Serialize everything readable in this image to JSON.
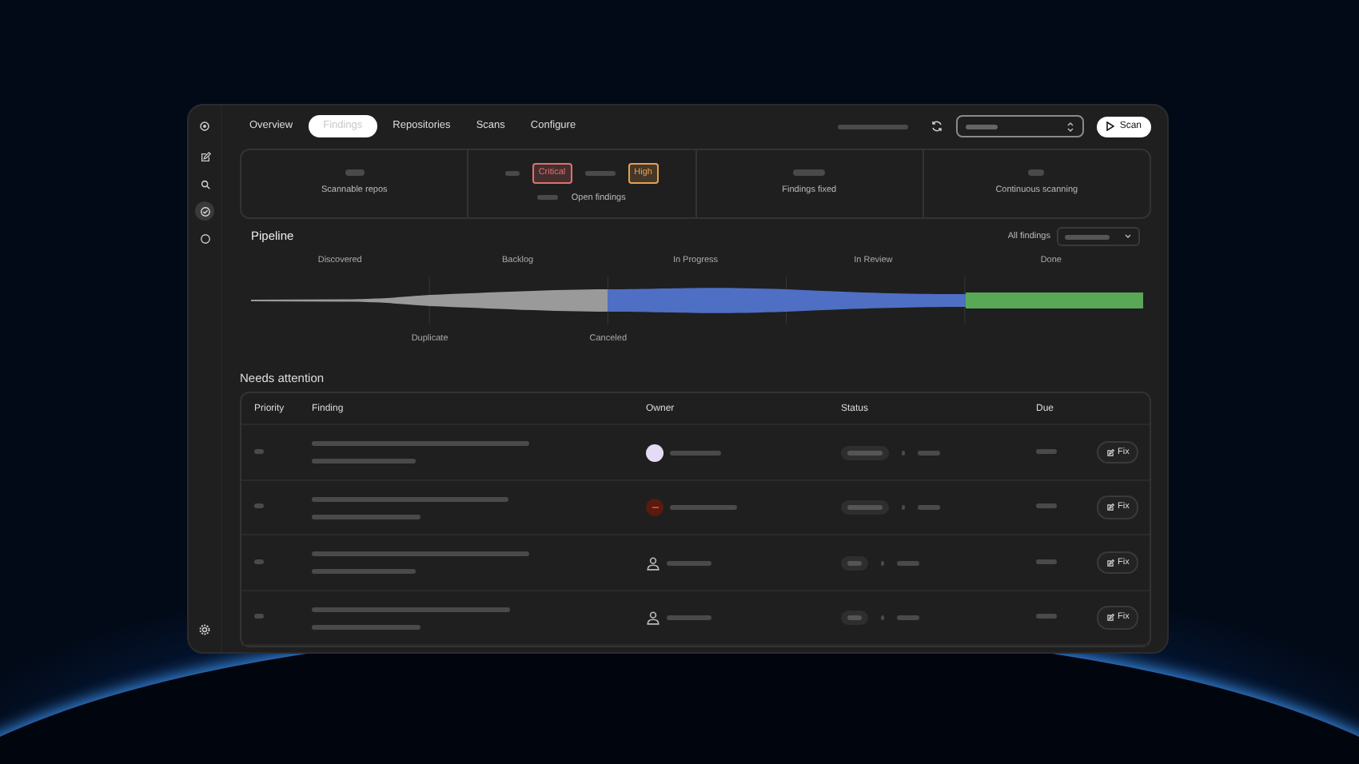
{
  "sidebar": {
    "items": [
      {
        "kind": "edit",
        "selected": false
      },
      {
        "kind": "search",
        "selected": false
      },
      {
        "kind": "check",
        "selected": true
      },
      {
        "kind": "chat",
        "selected": false
      }
    ]
  },
  "tabs": [
    {
      "label": "Overview",
      "selected": false
    },
    {
      "label": "Findings",
      "selected": true
    },
    {
      "label": "Repositories",
      "selected": false
    },
    {
      "label": "Scans",
      "selected": false
    },
    {
      "label": "Configure",
      "selected": false
    }
  ],
  "scan_button": "Scan",
  "stats": [
    {
      "label": "Scannable repos",
      "kind": "plain"
    },
    {
      "label": "Open findings",
      "kind": "severity",
      "badges": [
        {
          "label": "Critical",
          "color": "#e07070"
        },
        {
          "label": "High",
          "color": "#e8a050"
        }
      ]
    },
    {
      "label": "Findings fixed",
      "kind": "plain"
    },
    {
      "label": "Continuous scanning",
      "kind": "plain"
    }
  ],
  "pipeline": {
    "title": "Pipeline",
    "filter_label": "All findings",
    "stages": [
      "Discovered",
      "Backlog",
      "In Progress",
      "In Review",
      "Done"
    ],
    "exits": [
      "Duplicate",
      "Canceled"
    ]
  },
  "attention": {
    "title": "Needs attention",
    "columns": [
      "Priority",
      "Finding",
      "Owner",
      "Status",
      "Due"
    ],
    "rows": [
      {
        "kind": "avatar",
        "action": "Fix"
      },
      {
        "kind": "initials",
        "action": "Fix"
      },
      {
        "kind": "unassigned",
        "action": "Fix"
      },
      {
        "kind": "unassigned",
        "action": "Fix"
      }
    ]
  }
}
